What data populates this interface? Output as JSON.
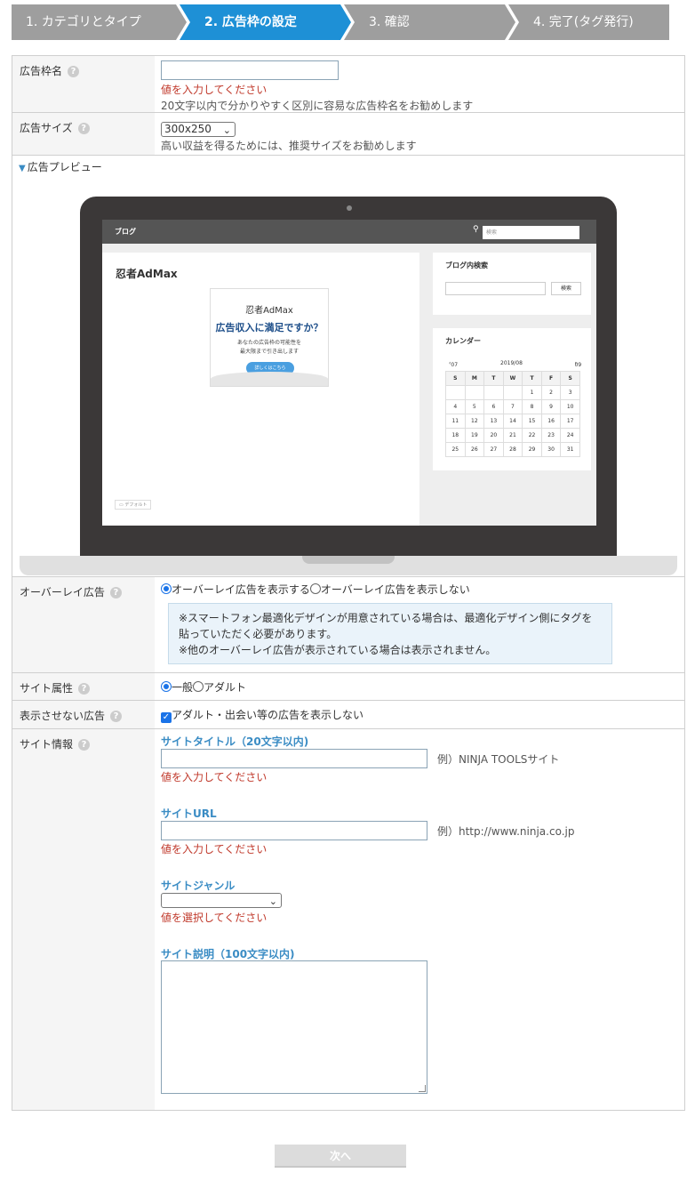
{
  "steps": [
    {
      "label": "1. カテゴリとタイプ",
      "active": false
    },
    {
      "label": "2. 広告枠の設定",
      "active": true
    },
    {
      "label": "3. 確認",
      "active": false
    },
    {
      "label": "4. 完了(タグ発行)",
      "active": false
    }
  ],
  "colors": {
    "step_inactive": "#9e9e9e",
    "step_active": "#1e90d6",
    "accent": "#3a8cc4",
    "error": "#c0392b",
    "notice_bg": "#eaf3fa"
  },
  "fields": {
    "ad_name": {
      "label": "広告枠名",
      "value": "",
      "error": "値を入力してください",
      "hint": "20文字以内で分かりやすく区別に容易な広告枠名をお勧めします"
    },
    "ad_size": {
      "label": "広告サイズ",
      "value": "300x250",
      "hint": "高い収益を得るためには、推奨サイズをお勧めします"
    },
    "preview": {
      "label": "広告プレビュー"
    },
    "overlay": {
      "label": "オーバーレイ広告",
      "option_show": "オーバーレイ広告を表示する",
      "option_hide": "オーバーレイ広告を表示しない",
      "selected": "show",
      "notice_line1": "※スマートフォン最適化デザインが用意されている場合は、最適化デザイン側にタグを",
      "notice_line2": "貼っていただく必要があります。",
      "notice_line3": "※他のオーバーレイ広告が表示されている場合は表示されません。"
    },
    "site_attr": {
      "label": "サイト属性",
      "option_general": "一般",
      "option_adult": "アダルト",
      "selected": "general"
    },
    "hide_ads": {
      "label": "表示させない広告",
      "option": "アダルト・出会い等の広告を表示しない",
      "checked": true
    },
    "site_info": {
      "label": "サイト情報",
      "title_label": "サイトタイトル（20文字以内)",
      "title_value": "",
      "title_example": "例）NINJA TOOLSサイト",
      "title_error": "値を入力してください",
      "url_label": "サイトURL",
      "url_value": "",
      "url_example": "例）http://www.ninja.co.jp",
      "url_error": "値を入力してください",
      "genre_label": "サイトジャンル",
      "genre_value": "",
      "genre_error": "値を選択してください",
      "desc_label": "サイト説明（100文字以内)",
      "desc_value": ""
    }
  },
  "mock": {
    "blog_label": "ブログ",
    "search_placeholder": "検索",
    "blog_title": "忍者AdMax",
    "ad_logo": "忍者AdMax",
    "ad_headline": "広告収入に満足ですか？",
    "ad_desc1": "あなたの広告枠の可能性を",
    "ad_desc2": "最大限まで引き出します",
    "ad_button": "詳しくはこちら",
    "folder": "デフォルト",
    "side_search_title": "ブログ内検索",
    "side_search_button": "検索",
    "calendar_title": "カレンダー",
    "calendar_prev": "07",
    "calendar_month": "2019/08",
    "calendar_next": "09",
    "calendar_days": [
      "S",
      "M",
      "T",
      "W",
      "T",
      "F",
      "S"
    ],
    "calendar_weeks": [
      [
        "",
        "",
        "",
        "",
        "1",
        "2",
        "3"
      ],
      [
        "4",
        "5",
        "6",
        "7",
        "8",
        "9",
        "10"
      ],
      [
        "11",
        "12",
        "13",
        "14",
        "15",
        "16",
        "17"
      ],
      [
        "18",
        "19",
        "20",
        "21",
        "22",
        "23",
        "24"
      ],
      [
        "25",
        "26",
        "27",
        "28",
        "29",
        "30",
        "31"
      ]
    ]
  },
  "next_button": "次へ"
}
